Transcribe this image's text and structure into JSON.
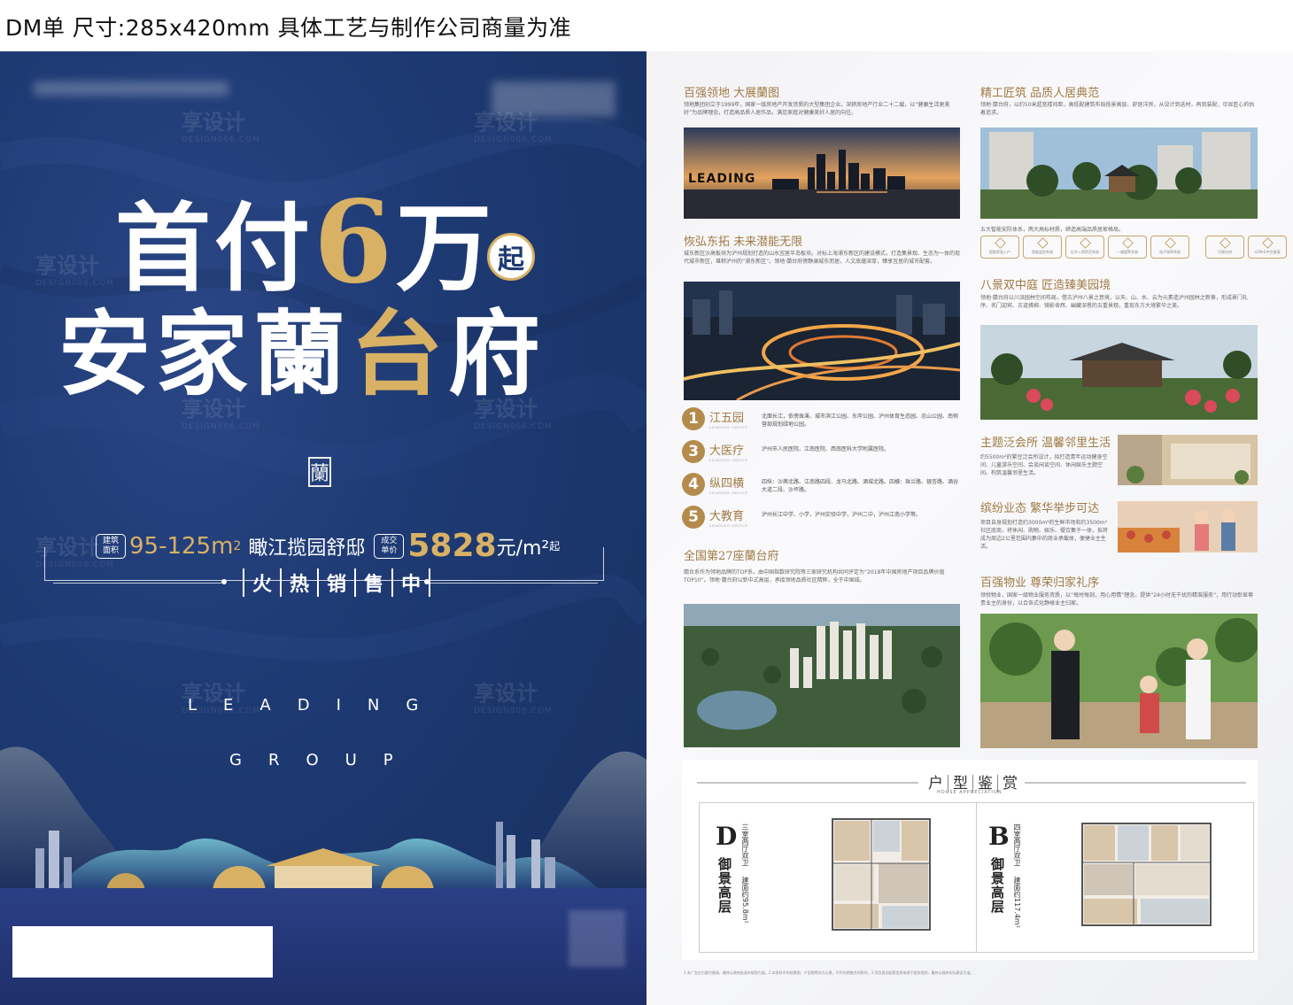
{
  "caption": "DM单 尺寸:285x420mm 具体工艺与制作公司商量为准",
  "poster": {
    "headline_line1_a": "首付",
    "headline_line1_gold": "6",
    "headline_line1_b": "万",
    "qi": "起",
    "headline_line2_a": "安家蘭",
    "headline_line2_gold": "台",
    "headline_line2_b": "府",
    "seal_char": "蘭",
    "tag_area_top": "建筑",
    "tag_area_bottom": "面积",
    "tag_area_yue": "约",
    "size_range": "95-125m",
    "size_sup": "2",
    "slogan": "瞰江揽园舒邸",
    "tag_price_top": "成交",
    "tag_price_bottom": "单价",
    "price": "5828",
    "price_unit": "元/m²",
    "price_qi": "起",
    "hot": [
      "火",
      "热",
      "销",
      "售",
      "中"
    ],
    "leading": "LEADING",
    "group": "GROUP",
    "watermark": "享设计",
    "watermark_sub": "DESIGN006.COM"
  },
  "brochure": {
    "s1_title": "百强领地  大展蘭图",
    "s1_text": "领地集团创立于1999年，国家一级房地产开发资质的大型集团企业。深耕房地产行业二十二载，以“健康生活更美好”为品牌理念，打造高品质人居作品，满足家庭对健康美好人居的向往。",
    "s1_img_text": "LEADING",
    "s2_title": "恢弘东拓  未来潜能无限",
    "s2_text": "城东新区沙高板块为泸州规划打造的山水宜居半岛板块。对标上海浦东新区的建设模式，打造集景观、生态为一体的现代城市新区，堪称泸州的“浦东新区”。领地·蘭台府傍静澜城东而居，人文底蕴深厚，臻享宜居的城市配套。",
    "items": [
      {
        "n": "1",
        "name": "江五园",
        "en": "LEADING GROUP",
        "desc": "北面长江，依傍珠溪、城市滨江公园、东岸公园、泸州体育生态园、忠山公园、南侧营部规划绿地公园。"
      },
      {
        "n": "3",
        "name": "大医疗",
        "en": "LEADING GROUP",
        "desc": "泸州市人民医院、江南医院、西南医科大学附属医院。"
      },
      {
        "n": "4",
        "name": "纵四横",
        "en": "LEADING GROUP",
        "desc": "四纵：沙茜北路、江南路四段、龙马北路、酒城北路。四横：珠兰路、银杏路、酒谷大道二段、沙坪路。"
      },
      {
        "n": "5",
        "name": "大教育",
        "en": "LEADING GROUP",
        "desc": "泸州长江中学、小学，泸州实验中学，泸州二中，泸州江南小学等。"
      }
    ],
    "s3_title": "全国第27座蘭台府",
    "s3_text": "蘭台系作为领地品牌的TOP系，由中国指数研究院等三家研究机构共同评定为“2018年中国房地产项目品牌价值TOP10”。领地·蘭台府以新中式高层，承接领地品质社区精粹，全于中国城。",
    "s4_title": "精工匠筑  品质人居典范",
    "s4_text": "领地·蘭台府，以约50米超宽楼间距，高低配建筑布局揽景高层、舒居洋房，从设计到选材，再到装配，尽显匠心的执着追求。",
    "s4_caption": "五大智能安防体系，两大高标材质，缔造高端品质居家格局。",
    "icons": [
      "智能家居入户",
      "智能监控系统",
      "红外入侵防范系统",
      "一键报警系统",
      "电子周界系统",
      "可视对讲",
      "LOW-E中空玻璃"
    ],
    "s5_title": "八景双中庭  匠造臻美园境",
    "s5_text": "领地·蘭台府以川派园林空间布局，借古泸州八景之意境，以天、山、水、云为元素造泸州园林之新章，形成景门礼序、名门迎宾、古道拂柳、镜影舍辉、幽藏深巷的五重景观，重现东方大境繁华之美。",
    "s6_title": "主题泛会所  温馨邻里生活",
    "s6_text": "约5500m²的繁豆泛会所设计，拟打造青年运动健身空间、儿童游乐空间、会谈闲谈空间、休闲娱乐主题空间、构筑温馨邻里生活。",
    "s7_title": "缤纷业态  繁华举步可达",
    "s7_text": "项目自身规划打造约3000m²的生鲜市场和约3500m²社区底商，将休闲、购物、娱乐、餐饮集于一体，拟将成为周边2公里范围内集中的商业承载体，便捷业主生活。",
    "s8_title": "百强物业  尊荣归家礼序",
    "s8_text": "领悦物业，国家一级物业服务资质，以“每时每刻，用心用情”理念，提供“24小时无干扰的精准服务”，用行动彰显尊贵业主的身份，以合各式化静候业主归家。",
    "fp_title": [
      "户",
      "型",
      "鉴",
      "赏"
    ],
    "fp_sub": "HOUSE APPRECIATION",
    "fp_d_letter": "D",
    "fp_d_layout": "三室两厅双卫",
    "fp_d_area": "建面约95.8m²",
    "fp_d_name": "御景高层",
    "fp_b_letter": "B",
    "fp_b_layout": "四室两厅双卫",
    "fp_b_area": "建面约117.4m²",
    "fp_b_name": "御景高层",
    "footnote": "1.本广告仅为要约邀请，最终以政府批准的规划为准。2.本资料中的效果图、户型图等仅为示意，不作为销售合同附件。3.项目周边配套信息来源于相关规划，最终以政府实际建设为准。"
  },
  "colors": {
    "navy": "#1e3a73",
    "gold": "#d8b165",
    "brochure_gold": "#a07a43"
  }
}
